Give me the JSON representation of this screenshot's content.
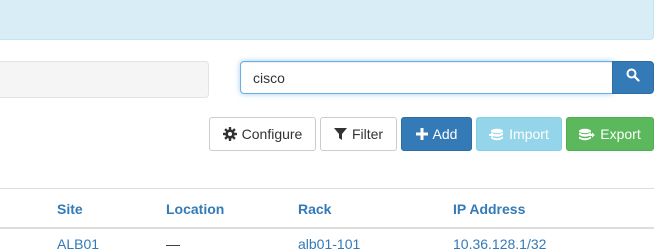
{
  "search": {
    "value": "cisco"
  },
  "toolbar": {
    "configure_label": "Configure",
    "filter_label": "Filter",
    "add_label": "Add",
    "import_label": "Import",
    "export_label": "Export"
  },
  "table": {
    "columns": [
      "Site",
      "Location",
      "Rack",
      "IP Address"
    ],
    "rows": [
      {
        "site": "ALB01",
        "location": "—",
        "rack": "alb01-101",
        "ip": "10.36.128.1/32"
      }
    ]
  },
  "colors": {
    "link": "#337ab7",
    "primary": "#337ab7",
    "info": "#5bc0de",
    "success": "#5cb85c",
    "alert_bg": "#d9edf7"
  },
  "icons": [
    "search-icon",
    "gear-icon",
    "filter-icon",
    "plus-icon",
    "import-icon",
    "export-icon"
  ]
}
